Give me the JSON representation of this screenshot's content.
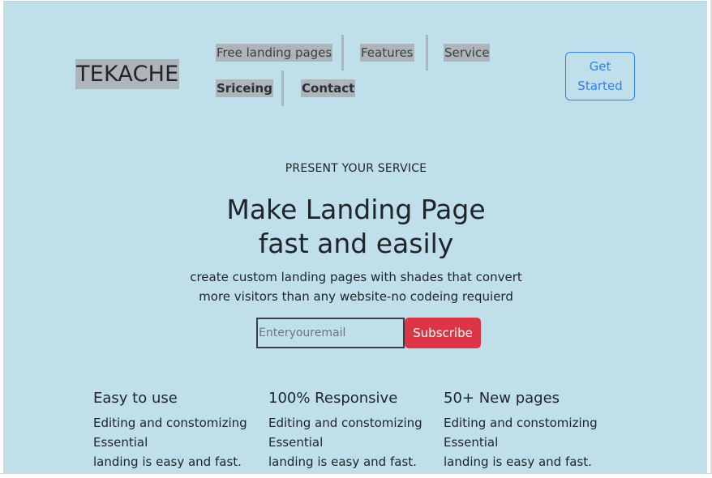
{
  "brand": "TEKACHE",
  "nav": {
    "links": [
      "Free landing pages",
      "Features",
      "Service",
      "Sriceing",
      "Contact"
    ]
  },
  "cta": {
    "get_started_line1": "Get",
    "get_started_line2": "Started"
  },
  "hero": {
    "eyebrow": "PRESENT YOUR SERVICE",
    "headline_line1": "Make Landing Page",
    "headline_line2": "fast and easily",
    "sub_line1": "create custom landing pages with shades that convert",
    "sub_line2": "more visitors than any website-no codeing requierd"
  },
  "subscribe": {
    "placeholder": "Enteryouremail",
    "button_label": "Subscribe"
  },
  "features": [
    {
      "title": "Easy to use",
      "line1": "Editing and constomizing",
      "line2": "Essential",
      "line3": "landing is easy and fast."
    },
    {
      "title": "100% Responsive",
      "line1": "Editing and constomizing",
      "line2": "Essential",
      "line3": "landing is easy and fast."
    },
    {
      "title": "50+ New pages",
      "line1": "Editing and constomizing",
      "line2": "Essential",
      "line3": "landing is easy and fast."
    }
  ],
  "colors": {
    "page_background": "#bfdfeb",
    "nav_highlight": "#adb5b8",
    "primary": "#2f7ff0",
    "danger": "#dc3545"
  }
}
